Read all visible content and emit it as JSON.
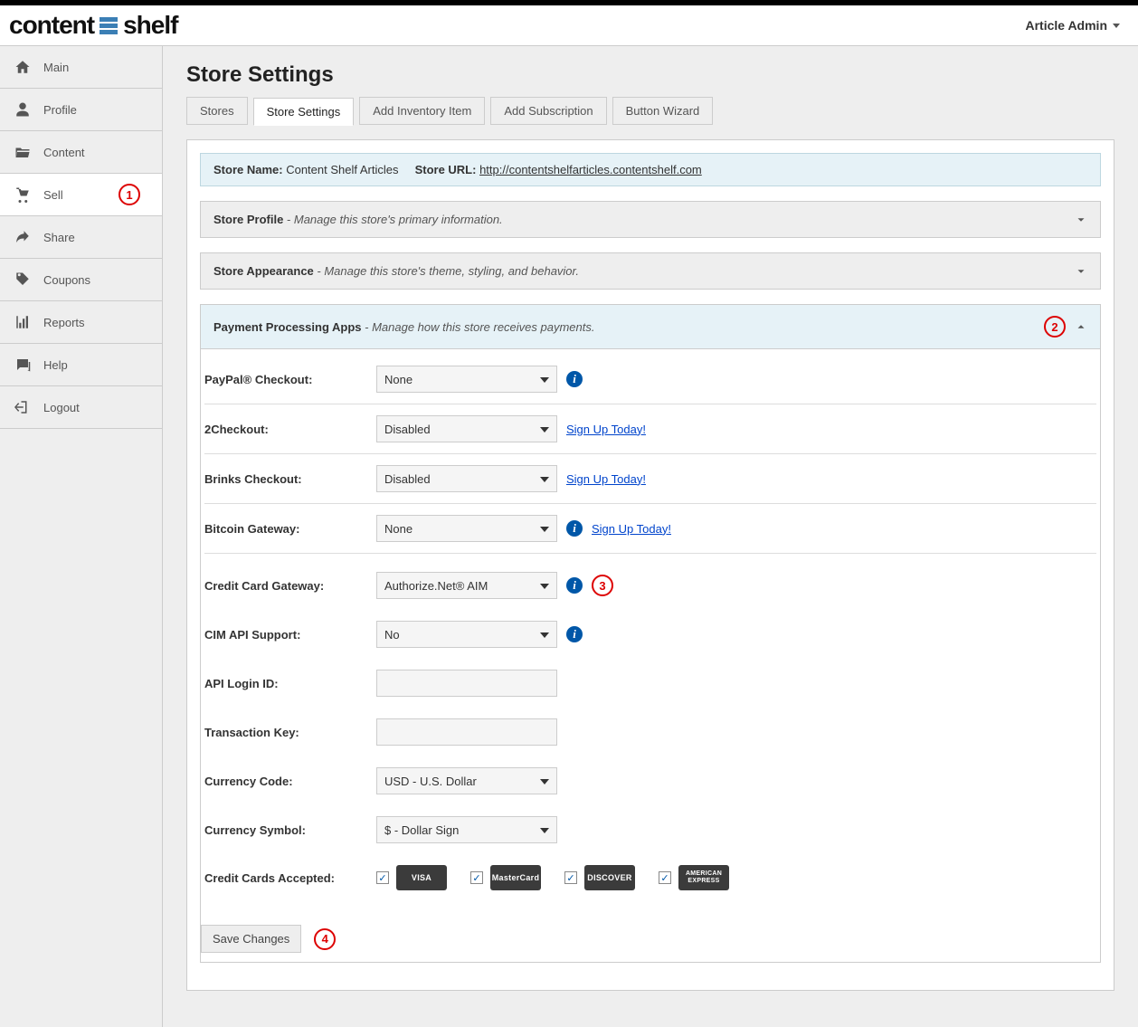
{
  "header": {
    "logo_left": "content",
    "logo_right": "shelf",
    "user_menu": "Article Admin"
  },
  "sidebar": {
    "items": [
      {
        "label": "Main"
      },
      {
        "label": "Profile"
      },
      {
        "label": "Content"
      },
      {
        "label": "Sell",
        "badge": "1"
      },
      {
        "label": "Share"
      },
      {
        "label": "Coupons"
      },
      {
        "label": "Reports"
      },
      {
        "label": "Help"
      },
      {
        "label": "Logout"
      }
    ]
  },
  "page": {
    "title": "Store Settings",
    "tabs": [
      "Stores",
      "Store Settings",
      "Add Inventory Item",
      "Add Subscription",
      "Button Wizard"
    ],
    "store_name_label": "Store Name:",
    "store_name_value": "Content Shelf Articles",
    "store_url_label": "Store URL:",
    "store_url_value": "http://contentshelfarticles.contentshelf.com"
  },
  "sections": {
    "profile": {
      "title": "Store Profile",
      "desc": "- Manage this store's primary information."
    },
    "appearance": {
      "title": "Store Appearance",
      "desc": "- Manage this store's theme, styling, and behavior."
    },
    "payment": {
      "title": "Payment Processing Apps",
      "desc": "- Manage how this store receives payments.",
      "badge": "2"
    }
  },
  "payment": {
    "paypal_label": "PayPal® Checkout:",
    "paypal_value": "None",
    "twocheckout_label": "2Checkout:",
    "twocheckout_value": "Disabled",
    "brinks_label": "Brinks Checkout:",
    "brinks_value": "Disabled",
    "bitcoin_label": "Bitcoin Gateway:",
    "bitcoin_value": "None",
    "cc_gateway_label": "Credit Card Gateway:",
    "cc_gateway_value": "Authorize.Net® AIM",
    "cc_gateway_badge": "3",
    "cim_label": "CIM API Support:",
    "cim_value": "No",
    "api_login_label": "API Login ID:",
    "api_login_value": "",
    "txn_key_label": "Transaction Key:",
    "txn_key_value": "",
    "currency_code_label": "Currency Code:",
    "currency_code_value": "USD - U.S. Dollar",
    "currency_symbol_label": "Currency Symbol:",
    "currency_symbol_value": "$ - Dollar Sign",
    "cards_accepted_label": "Credit Cards Accepted:",
    "signup_link": "Sign Up Today!",
    "cards": [
      "VISA",
      "MasterCard",
      "DISCOVER",
      "AMERICAN EXPRESS"
    ],
    "save_label": "Save Changes",
    "save_badge": "4"
  }
}
